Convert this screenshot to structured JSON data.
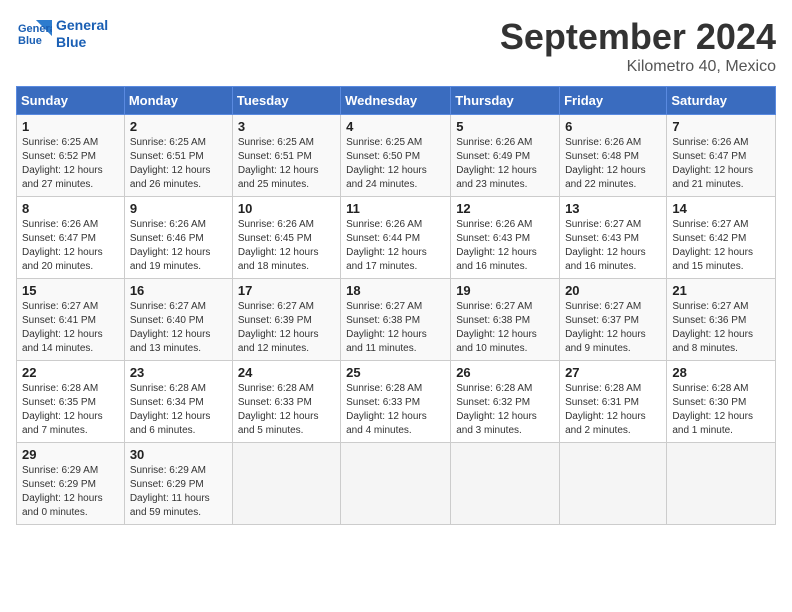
{
  "header": {
    "logo_line1": "General",
    "logo_line2": "Blue",
    "month": "September 2024",
    "location": "Kilometro 40, Mexico"
  },
  "weekdays": [
    "Sunday",
    "Monday",
    "Tuesday",
    "Wednesday",
    "Thursday",
    "Friday",
    "Saturday"
  ],
  "weeks": [
    [
      {
        "day": "1",
        "info": "Sunrise: 6:25 AM\nSunset: 6:52 PM\nDaylight: 12 hours\nand 27 minutes."
      },
      {
        "day": "2",
        "info": "Sunrise: 6:25 AM\nSunset: 6:51 PM\nDaylight: 12 hours\nand 26 minutes."
      },
      {
        "day": "3",
        "info": "Sunrise: 6:25 AM\nSunset: 6:51 PM\nDaylight: 12 hours\nand 25 minutes."
      },
      {
        "day": "4",
        "info": "Sunrise: 6:25 AM\nSunset: 6:50 PM\nDaylight: 12 hours\nand 24 minutes."
      },
      {
        "day": "5",
        "info": "Sunrise: 6:26 AM\nSunset: 6:49 PM\nDaylight: 12 hours\nand 23 minutes."
      },
      {
        "day": "6",
        "info": "Sunrise: 6:26 AM\nSunset: 6:48 PM\nDaylight: 12 hours\nand 22 minutes."
      },
      {
        "day": "7",
        "info": "Sunrise: 6:26 AM\nSunset: 6:47 PM\nDaylight: 12 hours\nand 21 minutes."
      }
    ],
    [
      {
        "day": "8",
        "info": "Sunrise: 6:26 AM\nSunset: 6:47 PM\nDaylight: 12 hours\nand 20 minutes."
      },
      {
        "day": "9",
        "info": "Sunrise: 6:26 AM\nSunset: 6:46 PM\nDaylight: 12 hours\nand 19 minutes."
      },
      {
        "day": "10",
        "info": "Sunrise: 6:26 AM\nSunset: 6:45 PM\nDaylight: 12 hours\nand 18 minutes."
      },
      {
        "day": "11",
        "info": "Sunrise: 6:26 AM\nSunset: 6:44 PM\nDaylight: 12 hours\nand 17 minutes."
      },
      {
        "day": "12",
        "info": "Sunrise: 6:26 AM\nSunset: 6:43 PM\nDaylight: 12 hours\nand 16 minutes."
      },
      {
        "day": "13",
        "info": "Sunrise: 6:27 AM\nSunset: 6:43 PM\nDaylight: 12 hours\nand 16 minutes."
      },
      {
        "day": "14",
        "info": "Sunrise: 6:27 AM\nSunset: 6:42 PM\nDaylight: 12 hours\nand 15 minutes."
      }
    ],
    [
      {
        "day": "15",
        "info": "Sunrise: 6:27 AM\nSunset: 6:41 PM\nDaylight: 12 hours\nand 14 minutes."
      },
      {
        "day": "16",
        "info": "Sunrise: 6:27 AM\nSunset: 6:40 PM\nDaylight: 12 hours\nand 13 minutes."
      },
      {
        "day": "17",
        "info": "Sunrise: 6:27 AM\nSunset: 6:39 PM\nDaylight: 12 hours\nand 12 minutes."
      },
      {
        "day": "18",
        "info": "Sunrise: 6:27 AM\nSunset: 6:38 PM\nDaylight: 12 hours\nand 11 minutes."
      },
      {
        "day": "19",
        "info": "Sunrise: 6:27 AM\nSunset: 6:38 PM\nDaylight: 12 hours\nand 10 minutes."
      },
      {
        "day": "20",
        "info": "Sunrise: 6:27 AM\nSunset: 6:37 PM\nDaylight: 12 hours\nand 9 minutes."
      },
      {
        "day": "21",
        "info": "Sunrise: 6:27 AM\nSunset: 6:36 PM\nDaylight: 12 hours\nand 8 minutes."
      }
    ],
    [
      {
        "day": "22",
        "info": "Sunrise: 6:28 AM\nSunset: 6:35 PM\nDaylight: 12 hours\nand 7 minutes."
      },
      {
        "day": "23",
        "info": "Sunrise: 6:28 AM\nSunset: 6:34 PM\nDaylight: 12 hours\nand 6 minutes."
      },
      {
        "day": "24",
        "info": "Sunrise: 6:28 AM\nSunset: 6:33 PM\nDaylight: 12 hours\nand 5 minutes."
      },
      {
        "day": "25",
        "info": "Sunrise: 6:28 AM\nSunset: 6:33 PM\nDaylight: 12 hours\nand 4 minutes."
      },
      {
        "day": "26",
        "info": "Sunrise: 6:28 AM\nSunset: 6:32 PM\nDaylight: 12 hours\nand 3 minutes."
      },
      {
        "day": "27",
        "info": "Sunrise: 6:28 AM\nSunset: 6:31 PM\nDaylight: 12 hours\nand 2 minutes."
      },
      {
        "day": "28",
        "info": "Sunrise: 6:28 AM\nSunset: 6:30 PM\nDaylight: 12 hours\nand 1 minute."
      }
    ],
    [
      {
        "day": "29",
        "info": "Sunrise: 6:29 AM\nSunset: 6:29 PM\nDaylight: 12 hours\nand 0 minutes."
      },
      {
        "day": "30",
        "info": "Sunrise: 6:29 AM\nSunset: 6:29 PM\nDaylight: 11 hours\nand 59 minutes."
      },
      {
        "day": "",
        "info": ""
      },
      {
        "day": "",
        "info": ""
      },
      {
        "day": "",
        "info": ""
      },
      {
        "day": "",
        "info": ""
      },
      {
        "day": "",
        "info": ""
      }
    ]
  ]
}
